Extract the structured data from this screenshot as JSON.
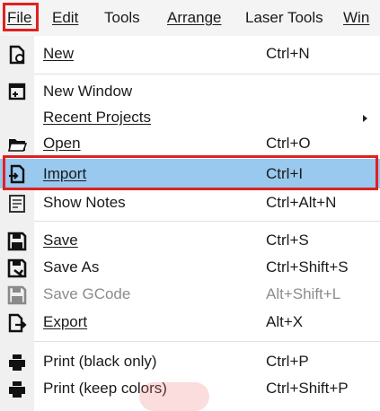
{
  "menubar": {
    "items": [
      {
        "label": "File",
        "active": true
      },
      {
        "label": "Edit"
      },
      {
        "label": "Tools"
      },
      {
        "label": "Arrange"
      },
      {
        "label": "Laser Tools"
      },
      {
        "label": "Win"
      }
    ]
  },
  "file_menu": {
    "items": [
      {
        "label": "New",
        "shortcut": "Ctrl+N",
        "icon": "new-file-icon"
      },
      {
        "label": "New Window",
        "shortcut": "",
        "icon": "new-window-icon"
      },
      {
        "label": "Recent Projects",
        "shortcut": "",
        "icon": "",
        "submenu": true
      },
      {
        "label": "Open",
        "shortcut": "Ctrl+O",
        "icon": "folder-icon"
      },
      {
        "label": "Import",
        "shortcut": "Ctrl+I",
        "icon": "import-icon",
        "highlighted": true
      },
      {
        "label": "Show Notes",
        "shortcut": "Ctrl+Alt+N",
        "icon": "notes-icon"
      },
      {
        "label": "Save",
        "shortcut": "Ctrl+S",
        "icon": "save-icon"
      },
      {
        "label": "Save As",
        "shortcut": "Ctrl+Shift+S",
        "icon": "save-as-icon"
      },
      {
        "label": "Save GCode",
        "shortcut": "Alt+Shift+L",
        "icon": "save-gcode-icon",
        "disabled": true
      },
      {
        "label": "Export",
        "shortcut": "Alt+X",
        "icon": "export-icon"
      },
      {
        "label": "Print (black only)",
        "shortcut": "Ctrl+P",
        "icon": "printer-icon"
      },
      {
        "label": "Print (keep colors)",
        "shortcut": "Ctrl+Shift+P",
        "icon": "printer-color-icon"
      }
    ]
  },
  "colors": {
    "highlight": "#99c9ef",
    "annotation_red": "#e02020",
    "disabled_text": "#8c8c8c"
  }
}
